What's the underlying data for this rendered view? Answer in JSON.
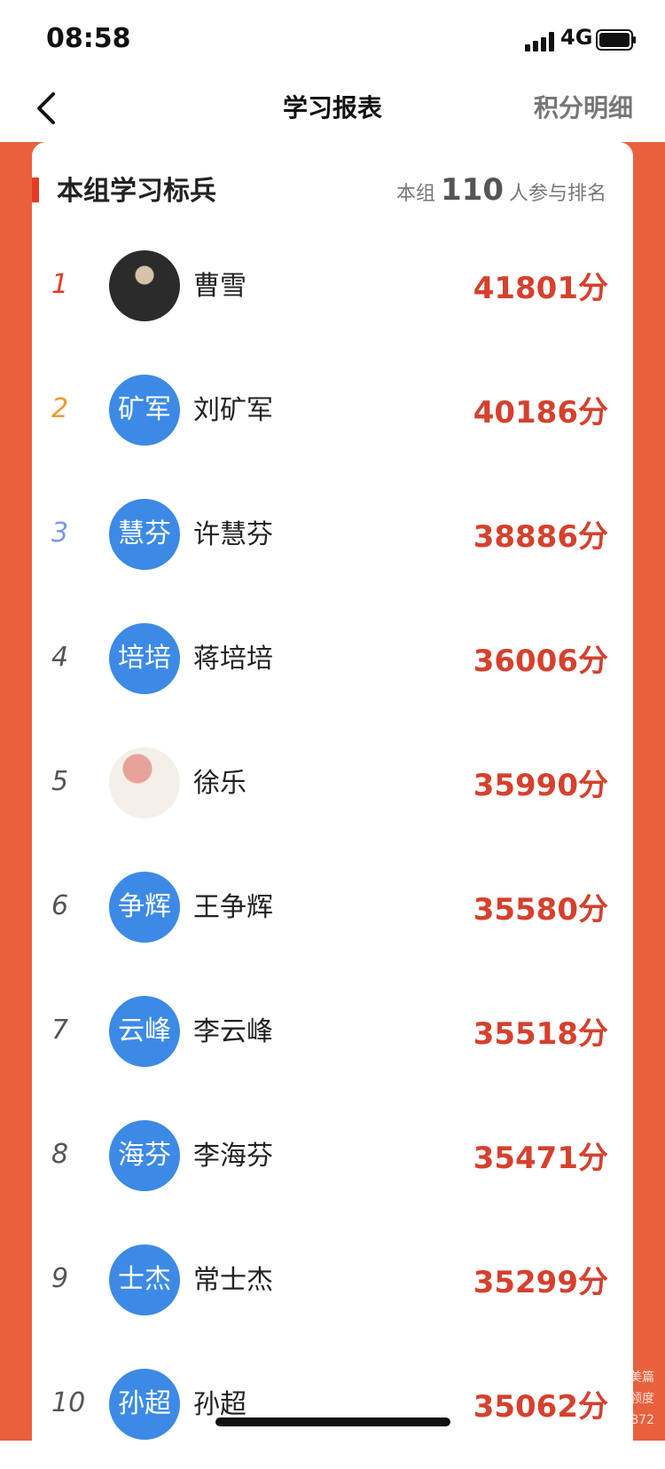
{
  "status_bar": {
    "time": "08:58",
    "network": "4G"
  },
  "nav": {
    "title": "学习报表",
    "detail_link": "积分明细"
  },
  "group": {
    "title": "本组学习标兵",
    "participants_prefix": "本组",
    "participants_count": "110",
    "participants_suffix": "人参与排名"
  },
  "ranking": [
    {
      "rank": "1",
      "avatar": "",
      "name": "曹雪",
      "score": "41801分",
      "rank_color": "#e23b24"
    },
    {
      "rank": "2",
      "avatar": "矿军",
      "name": "刘矿军",
      "score": "40186分",
      "rank_color": "#ef9a34"
    },
    {
      "rank": "3",
      "avatar": "慧芬",
      "name": "许慧芬",
      "score": "38886分",
      "rank_color": "#7a98e6"
    },
    {
      "rank": "4",
      "avatar": "培培",
      "name": "蒋培培",
      "score": "36006分",
      "rank_color": "#555555"
    },
    {
      "rank": "5",
      "avatar": "",
      "name": "徐乐",
      "score": "35990分",
      "rank_color": "#555555"
    },
    {
      "rank": "6",
      "avatar": "争辉",
      "name": "王争辉",
      "score": "35580分",
      "rank_color": "#555555"
    },
    {
      "rank": "7",
      "avatar": "云峰",
      "name": "李云峰",
      "score": "35518分",
      "rank_color": "#555555"
    },
    {
      "rank": "8",
      "avatar": "海芬",
      "name": "李海芬",
      "score": "35471分",
      "rank_color": "#555555"
    },
    {
      "rank": "9",
      "avatar": "士杰",
      "name": "常士杰",
      "score": "35299分",
      "rank_color": "#555555"
    },
    {
      "rank": "10",
      "avatar": "孙超",
      "name": "孙超",
      "score": "35062分",
      "rank_color": "#555555"
    }
  ],
  "watermark": {
    "line1": "美篇",
    "line2": "领度",
    "line3": "872"
  }
}
